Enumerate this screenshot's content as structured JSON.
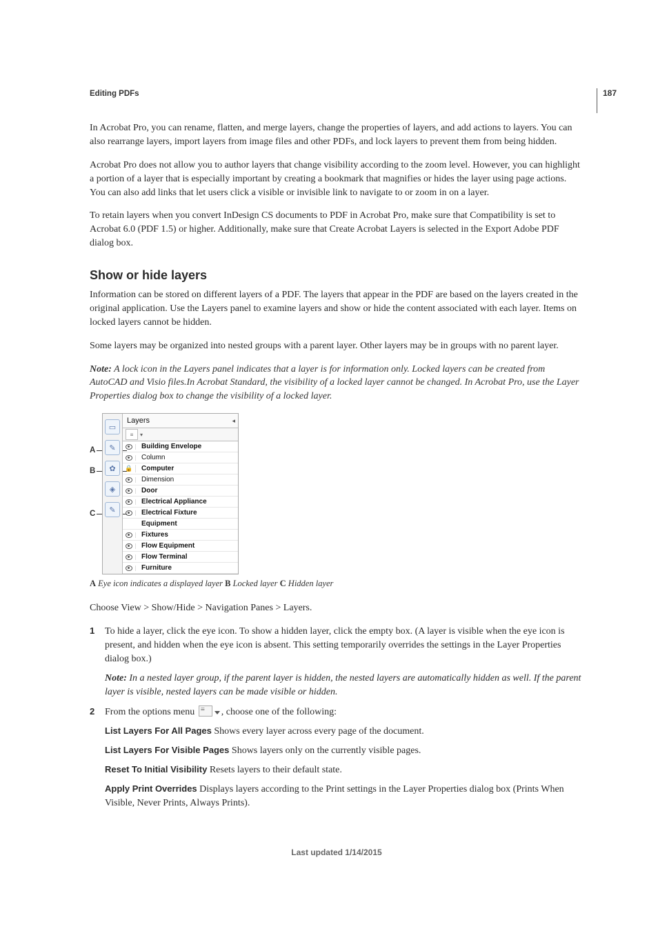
{
  "page_number": "187",
  "section_tag": "Editing PDFs",
  "paragraphs": {
    "p1": "In Acrobat Pro, you can rename, flatten, and merge layers, change the properties of layers, and add actions to layers. You can also rearrange layers, import layers from image files and other PDFs, and lock layers to prevent them from being hidden.",
    "p2": "Acrobat Pro does not allow you to author layers that change visibility according to the zoom level. However, you can highlight a portion of a layer that is especially important by creating a bookmark that magnifies or hides the layer using page actions. You can also add links that let users click a visible or invisible link to navigate to or zoom in on a layer.",
    "p3": "To retain layers when you convert InDesign CS documents to PDF in Acrobat Pro, make sure that Compatibility is set to Acrobat 6.0 (PDF 1.5) or higher. Additionally, make sure that Create Acrobat Layers is selected in the Export Adobe PDF dialog box."
  },
  "heading": "Show or hide layers",
  "after_heading": {
    "p1": "Information can be stored on different layers of a PDF. The layers that appear in the PDF are based on the layers created in the original application. Use the Layers panel to examine layers and show or hide the content associated with each layer. Items on locked layers cannot be hidden.",
    "p2": "Some layers may be organized into nested groups with a parent layer. Other layers may be in groups with no parent layer."
  },
  "note1": {
    "label": "Note:",
    "text": " A lock icon in the Layers panel indicates that a layer is for information only. Locked layers can be created from AutoCAD and Visio files.In Acrobat Standard, the visibility of a locked layer cannot be changed. In Acrobat Pro, use the Layer Properties dialog box to change the visibility of a locked layer."
  },
  "layers_panel": {
    "title": "Layers",
    "layers": [
      {
        "name": "Building Envelope",
        "bold": true,
        "state": "eye"
      },
      {
        "name": "Column",
        "bold": false,
        "state": "eye"
      },
      {
        "name": "Computer",
        "bold": true,
        "state": "lock"
      },
      {
        "name": "Dimension",
        "bold": false,
        "state": "eye"
      },
      {
        "name": "Door",
        "bold": true,
        "state": "eye"
      },
      {
        "name": "Electrical Appliance",
        "bold": true,
        "state": "eye"
      },
      {
        "name": "Electrical Fixture",
        "bold": true,
        "state": "eye"
      },
      {
        "name": "Equipment",
        "bold": true,
        "state": "empty"
      },
      {
        "name": "Fixtures",
        "bold": true,
        "state": "eye"
      },
      {
        "name": "Flow Equipment",
        "bold": true,
        "state": "eye"
      },
      {
        "name": "Flow Terminal",
        "bold": true,
        "state": "eye"
      },
      {
        "name": "Furniture",
        "bold": true,
        "state": "eye"
      }
    ]
  },
  "caption": {
    "a_key": "A",
    "a_text": " Eye icon indicates a displayed layer  ",
    "b_key": "B",
    "b_text": " Locked layer  ",
    "c_key": "C",
    "c_text": " Hidden layer"
  },
  "choose_path": "Choose View > Show/Hide > Navigation Panes > Layers.",
  "step1": {
    "text": "To hide a layer, click the eye icon. To show a hidden layer, click the empty box. (A layer is visible when the eye icon is present, and hidden when the eye icon is absent. This setting temporarily overrides the settings in the Layer Properties dialog box.)",
    "note_label": "Note:",
    "note_text": " In a nested layer group, if the parent layer is hidden, the nested layers are automatically hidden as well. If the parent layer is visible,  nested layers can be made visible or hidden."
  },
  "step2": {
    "lead_a": "From the options menu ",
    "lead_b": ", choose one of the following:",
    "opts": {
      "o1h": "List Layers For All Pages",
      "o1t": "  Shows every layer across every page of the document.",
      "o2h": "List Layers For Visible Pages",
      "o2t": "  Shows layers only on the currently visible pages.",
      "o3h": "Reset To Initial Visibility",
      "o3t": "  Resets layers to their default state.",
      "o4h": "Apply Print Overrides",
      "o4t": "  Displays layers according to the Print settings in the Layer Properties dialog box (Prints When Visible, Never Prints, Always Prints)."
    }
  },
  "footer": "Last updated 1/14/2015"
}
